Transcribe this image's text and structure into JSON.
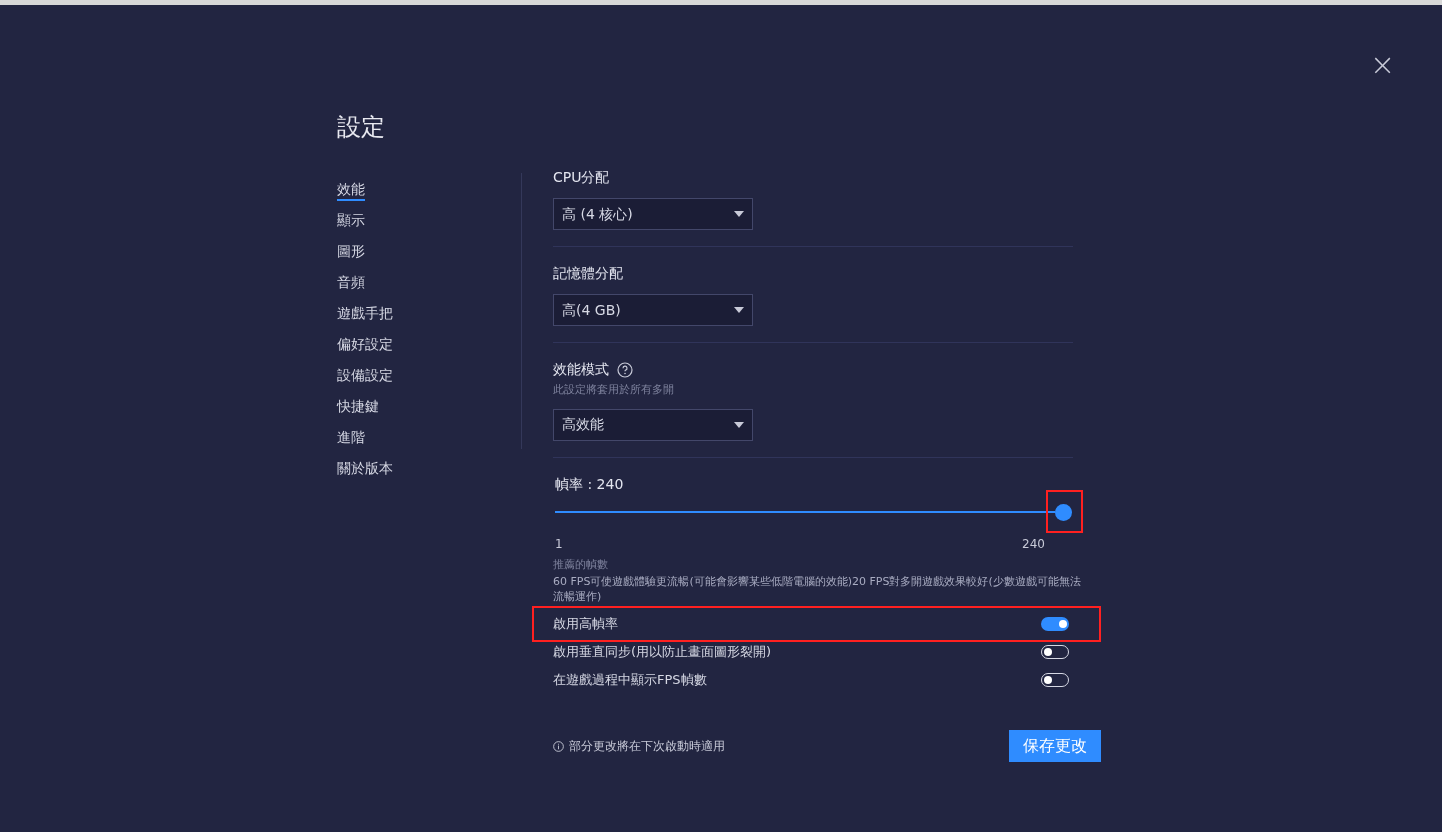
{
  "title": "設定",
  "close": "×",
  "sidebar": [
    {
      "label": "效能",
      "selected": true
    },
    {
      "label": "顯示",
      "selected": false
    },
    {
      "label": "圖形",
      "selected": false
    },
    {
      "label": "音頻",
      "selected": false
    },
    {
      "label": "遊戲手把",
      "selected": false
    },
    {
      "label": "偏好設定",
      "selected": false
    },
    {
      "label": "設備設定",
      "selected": false
    },
    {
      "label": "快捷鍵",
      "selected": false
    },
    {
      "label": "進階",
      "selected": false
    },
    {
      "label": "關於版本",
      "selected": false
    }
  ],
  "dropdowns": [
    {
      "label": "CPU分配",
      "value": "高 (4 核心)"
    },
    {
      "label": "記憶體分配",
      "value": "高(4 GB)"
    },
    {
      "label": "效能模式",
      "help": true,
      "hint": "此設定將套用於所有多開",
      "value": "高效能"
    }
  ],
  "frame_rate": {
    "label": "幀率 : 240",
    "level": 1,
    "min": "1",
    "max": "240"
  },
  "recommend": {
    "title": "推薦的幀數",
    "text": "60 FPS可使遊戲體驗更流暢(可能會影響某些低階電腦的效能)20 FPS對多開遊戲效果較好(少數遊戲可能無法流暢運作)"
  },
  "toggles": [
    {
      "label": "啟用高幀率",
      "on": true
    },
    {
      "label": "啟用垂直同步(用以防止畫面圖形裂開)",
      "on": false
    },
    {
      "label": "在遊戲過程中顯示FPS幀數",
      "on": false
    }
  ],
  "footer": {
    "note": "部分更改將在下次啟動時適用",
    "save": "保存更改"
  }
}
